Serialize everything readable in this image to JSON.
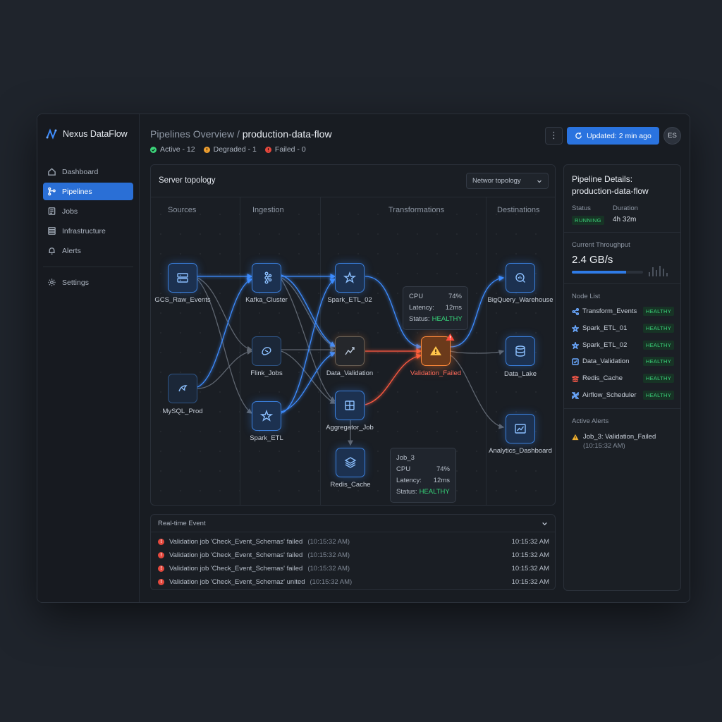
{
  "app": {
    "name": "Nexus DataFlow"
  },
  "sidebar": {
    "items": [
      {
        "label": "Dashboard",
        "icon": "home-icon"
      },
      {
        "label": "Pipelines",
        "icon": "pipeline-icon",
        "active": true
      },
      {
        "label": "Jobs",
        "icon": "jobs-icon"
      },
      {
        "label": "Infrastructure",
        "icon": "server-icon"
      },
      {
        "label": "Alerts",
        "icon": "bell-icon"
      },
      {
        "label": "Settings",
        "icon": "gear-icon"
      }
    ]
  },
  "header": {
    "breadcrumb_parent": "Pipelines Overview /",
    "breadcrumb_current": "production-data-flow",
    "status": {
      "active": "Active - 12",
      "degraded": "Degraded - 1",
      "failed": "Failed - 0"
    },
    "menu_label": "⋮",
    "update_label": "Updated: 2 min ago",
    "avatar_initials": "ES"
  },
  "topology": {
    "title": "Server topology",
    "view_select": "Networ topology",
    "columns": [
      "Sources",
      "Ingestion",
      "Transformations",
      "Destinations"
    ],
    "nodes": {
      "gcs": "GCS_Raw_Events",
      "mysql": "MySQL_Prod",
      "kafka": "Kafka_Cluster",
      "flink": "Flink_Jobs",
      "spark_etl": "Spark_ETL",
      "spark_etl_02": "Spark_ETL_02",
      "data_validation": "Data_Validation",
      "aggregator": "Aggregator_Job",
      "redis": "Redis_Cache",
      "validation_failed": "Validation_Failed",
      "bigquery": "BigQuery_Warehouse",
      "data_lake": "Data_Lake",
      "analytics": "Analytics_Dashboard"
    },
    "tooltip1": {
      "cpu_label": "CPU",
      "cpu": "74%",
      "latency_label": "Latency:",
      "latency": "12ms",
      "status_label": "Status:",
      "status": "HEALTHY"
    },
    "tooltip2": {
      "job": "Job_3",
      "cpu_label": "CPU",
      "cpu": "74%",
      "latency_label": "Latency:",
      "latency": "12ms",
      "status_label": "Status:",
      "status": "HEALTHY"
    }
  },
  "events": {
    "title": "Real-time Event",
    "rows": [
      {
        "text": "Validation job 'Check_Event_Schemas' failed",
        "time_in": "(10:15:32 AM)",
        "time": "10:15:32 AM"
      },
      {
        "text": "Validation job 'Check_Event_Schemas' failed",
        "time_in": "(10:15:32 AM)",
        "time": "10:15:32 AM"
      },
      {
        "text": "Validation job 'Check_Event_Schemas' failed",
        "time_in": "(10:15:32 AM)",
        "time": "10:15:32 AM"
      },
      {
        "text": "Validation job 'Check_Event_Schemaz' united",
        "time_in": "(10:15:32 AM)",
        "time": "10:15:32 AM"
      }
    ]
  },
  "details": {
    "title_line1": "Pipeline Details:",
    "title_line2": "production-data-flow",
    "status_label": "Status",
    "status_value": "RUNNING",
    "duration_label": "Duration",
    "duration_value": "4h 32m",
    "throughput_label": "Current Throughput",
    "throughput_value": "2.4 GB/s",
    "throughput_fraction": 0.76,
    "node_list_label": "Node List",
    "node_list": [
      {
        "name": "Transform_Events",
        "status": "HEALTHY"
      },
      {
        "name": "Spark_ETL_01",
        "status": "HEALTHY"
      },
      {
        "name": "Spark_ETL_02",
        "status": "HEALTHY"
      },
      {
        "name": "Data_Validation",
        "status": "HEALTHY"
      },
      {
        "name": "Redis_Cache",
        "status": "HEALTHY"
      },
      {
        "name": "Airflow_Scheduler",
        "status": "HEALTHY"
      }
    ],
    "alerts_label": "Active Alerts",
    "alert_text": "Job_3: Validation_Failed",
    "alert_time": "(10:15:32 AM)"
  },
  "colors": {
    "accent": "#2a73df",
    "healthy": "#3bd47a",
    "degraded": "#f0a030",
    "failed": "#e5483d",
    "edge_blue": "#3d8cff",
    "edge_red": "#ff5a40"
  }
}
